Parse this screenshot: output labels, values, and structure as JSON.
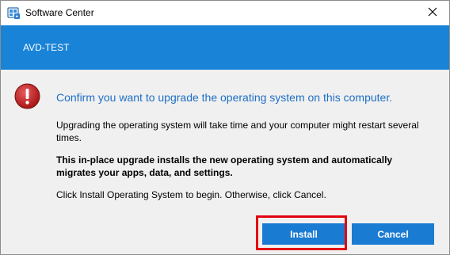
{
  "window": {
    "title": "Software Center",
    "app_icon": "software-center-icon",
    "close_icon": "close-icon"
  },
  "banner": {
    "text": "AVD-TEST",
    "color": "#1883d7"
  },
  "dialog": {
    "icon": "error-icon",
    "heading": "Confirm you want to upgrade the operating system on this computer.",
    "paragraph1": "Upgrading the operating system will take time and your computer might restart several times.",
    "paragraph2": "This in-place upgrade installs the new operating system and automatically migrates your apps, data, and settings.",
    "paragraph3": "Click Install Operating System to begin. Otherwise, click Cancel."
  },
  "buttons": {
    "install_label": "Install",
    "cancel_label": "Cancel",
    "button_color": "#1a7bd3"
  },
  "highlight": {
    "color": "#e3000f",
    "target": "install-button"
  }
}
